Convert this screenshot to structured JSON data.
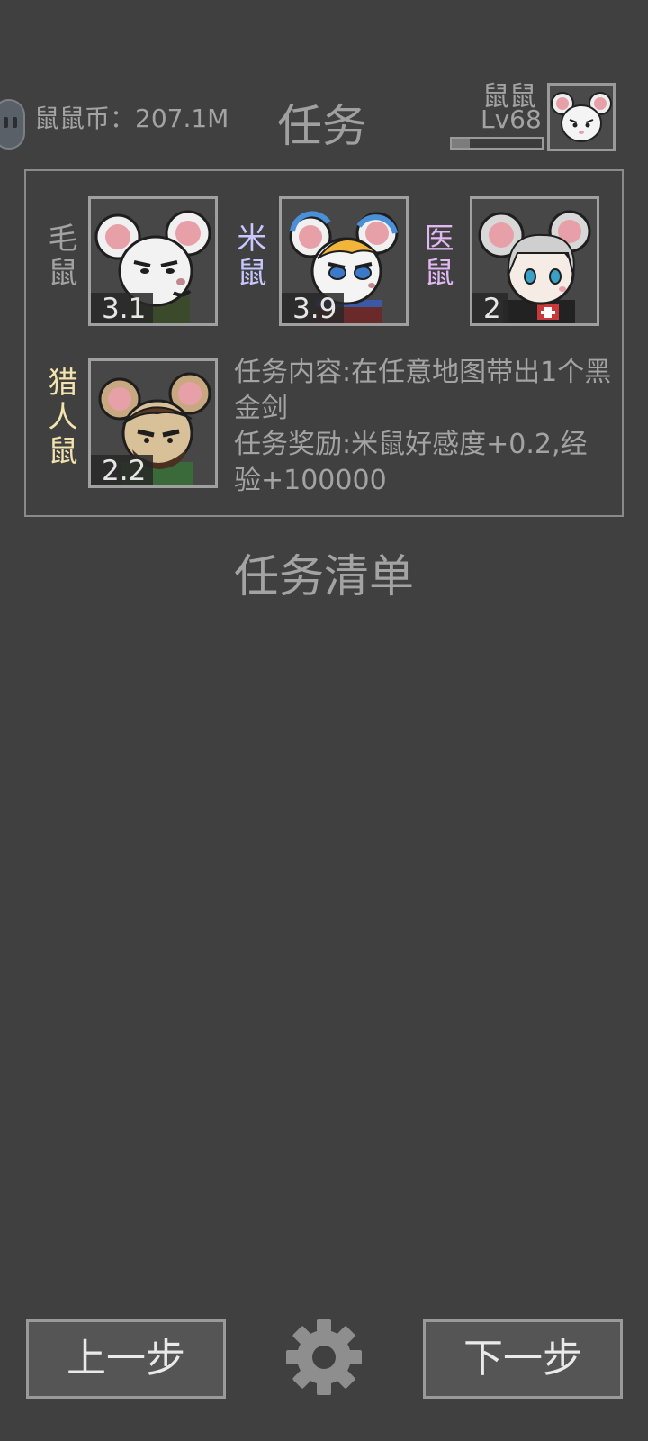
{
  "header": {
    "coin_text": "鼠鼠币：207.1M",
    "title": "任务",
    "player_name": "鼠鼠",
    "player_level": "Lv68",
    "xp_progress": 0.2
  },
  "npcs": [
    {
      "name_line1": "毛",
      "name_line2": "鼠",
      "affinity": "3.1",
      "name_color": "#a3a3a3"
    },
    {
      "name_line1": "米",
      "name_line2": "鼠",
      "affinity": "3.9",
      "name_color": "#c8c8ff"
    },
    {
      "name_line1": "医",
      "name_line2": "鼠",
      "affinity": "2",
      "name_color": "#e0b8f2"
    },
    {
      "name_line1": "猎",
      "name_line2": "人",
      "name_line3": "鼠",
      "affinity": "2.2",
      "name_color": "#f3e4ae"
    }
  ],
  "task": {
    "content": "任务内容:在任意地图带出1个黑金剑",
    "reward": "任务奖励:米鼠好感度+0.2,经验+100000"
  },
  "list_title": "任务清单",
  "buttons": {
    "prev": "上一步",
    "next": "下一步"
  },
  "icons": [
    "settings-gear-icon",
    "side-tab-icon"
  ]
}
